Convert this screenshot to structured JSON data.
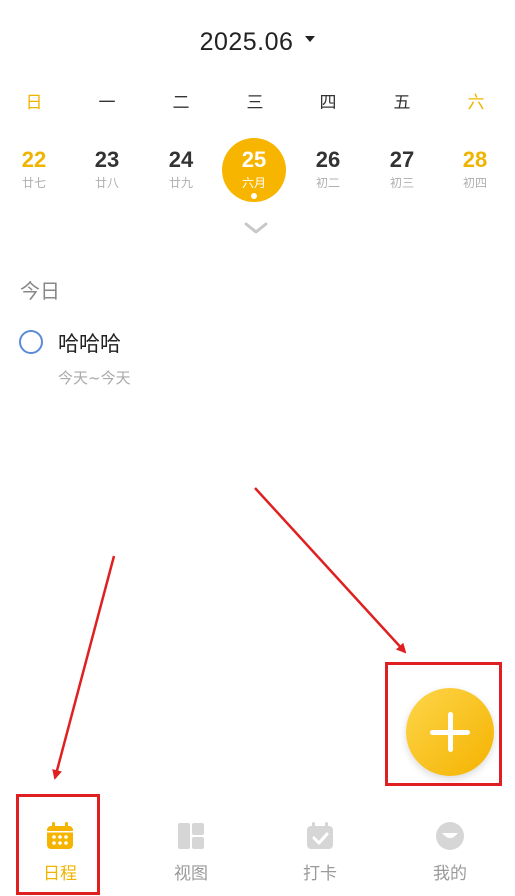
{
  "header": {
    "month": "2025.06"
  },
  "weekdays": [
    "日",
    "一",
    "二",
    "三",
    "四",
    "五",
    "六"
  ],
  "dates": [
    {
      "day": "22",
      "lunar": "廿七"
    },
    {
      "day": "23",
      "lunar": "廿八"
    },
    {
      "day": "24",
      "lunar": "廿九"
    },
    {
      "day": "25",
      "lunar": "六月"
    },
    {
      "day": "26",
      "lunar": "初二"
    },
    {
      "day": "27",
      "lunar": "初三"
    },
    {
      "day": "28",
      "lunar": "初四"
    }
  ],
  "section": {
    "title": "今日"
  },
  "task": {
    "title": "哈哈哈",
    "date_range": "今天~今天"
  },
  "nav": {
    "items": [
      {
        "label": "日程"
      },
      {
        "label": "视图"
      },
      {
        "label": "打卡"
      },
      {
        "label": "我的"
      }
    ]
  },
  "colors": {
    "accent": "#f7b500",
    "annotation_red": "#e02020",
    "task_circle": "#5b8bd6"
  },
  "icons": {
    "caret": "caret-down-icon",
    "expand": "chevron-down-icon",
    "fab": "plus-icon",
    "nav": [
      "calendar-icon",
      "grid-view-icon",
      "check-in-icon",
      "profile-icon"
    ]
  }
}
